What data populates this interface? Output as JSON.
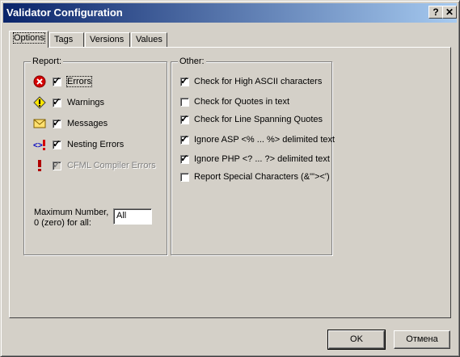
{
  "window": {
    "title": "Validator Configuration",
    "help_label": "?",
    "close_label": "✕"
  },
  "tabs": [
    {
      "label": "Options",
      "active": true
    },
    {
      "label": "Tags",
      "active": false
    },
    {
      "label": "Versions",
      "active": false
    },
    {
      "label": "Values",
      "active": false
    }
  ],
  "report": {
    "legend": "Report:",
    "items": [
      {
        "label": "Errors",
        "checked": true,
        "icon": "error-icon",
        "enabled": true
      },
      {
        "label": "Warnings",
        "checked": true,
        "icon": "warning-icon",
        "enabled": true
      },
      {
        "label": "Messages",
        "checked": true,
        "icon": "message-envelope-icon",
        "enabled": true
      },
      {
        "label": "Nesting Errors",
        "checked": true,
        "icon": "nesting-error-icon",
        "enabled": true
      },
      {
        "label": "CFML Compiler Errors",
        "checked": true,
        "icon": "exclamation-icon",
        "enabled": false
      }
    ],
    "max_number_label_1": "Maximum Number,",
    "max_number_label_2": "0 (zero) for all:",
    "max_number_value": "All"
  },
  "other": {
    "legend": "Other:",
    "items": [
      {
        "label": "Check for High ASCII characters",
        "checked": true
      },
      {
        "label": "Check for Quotes in text",
        "checked": false
      },
      {
        "label": "Check for Line Spanning Quotes",
        "checked": true
      },
      {
        "label": "Ignore ASP <% ... %> delimited text",
        "checked": true
      },
      {
        "label": "Ignore PHP <? ... ?> delimited text",
        "checked": true
      },
      {
        "label": "Report Special Characters (&'\"><')",
        "checked": false
      }
    ]
  },
  "buttons": {
    "ok_label": "OK",
    "cancel_label": "Отмена"
  },
  "colors": {
    "title_gradient_start": "#0a246a",
    "title_gradient_end": "#a6caf0",
    "face": "#d4d0c8"
  }
}
